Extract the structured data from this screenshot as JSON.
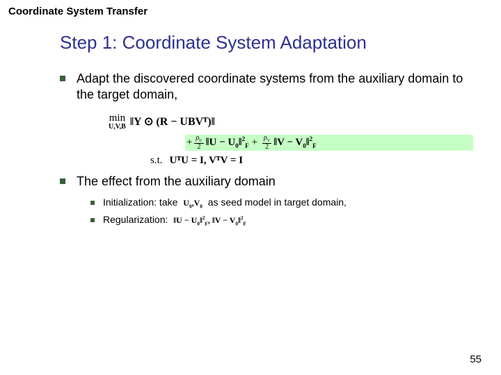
{
  "header": {
    "title": "Coordinate System Transfer"
  },
  "main": {
    "title": "Step 1: Coordinate System Adaptation"
  },
  "bullets": {
    "one": "Adapt the discovered coordinate systems from the auxiliary domain to the target domain,",
    "two": "The effect from the auxiliary domain",
    "sub1_prefix": "Initialization: take",
    "sub1_suffix": "as seed model in target domain,",
    "sub2": "Regularization:"
  },
  "formula": {
    "min": "min",
    "min_under": "U,V,B",
    "line1_body": "‖Y ⊙ (R − UBVᵀ)‖",
    "plus": "+",
    "rho_u_num": "ρ",
    "rho_u_sub": "U",
    "two": "2",
    "u_term_a": "‖U − U",
    "u_term_b": "0",
    "u_term_c": "‖",
    "fsup": "2",
    "fsub": "F",
    "rho_v_sub": "V",
    "v_term_a": "‖V − V",
    "st": "s.t.",
    "constraint": "UᵀU = I, VᵀV = I"
  },
  "seed": {
    "u": "U",
    "v": "V",
    "zero": "0",
    "comma": ","
  },
  "reg": {
    "part_a": "‖U − U",
    "part_b": "0",
    "part_c": "‖",
    "sup": "2",
    "sub": "F",
    "sep": ",",
    "part_d": "‖V − V"
  },
  "page": {
    "number": "55"
  }
}
